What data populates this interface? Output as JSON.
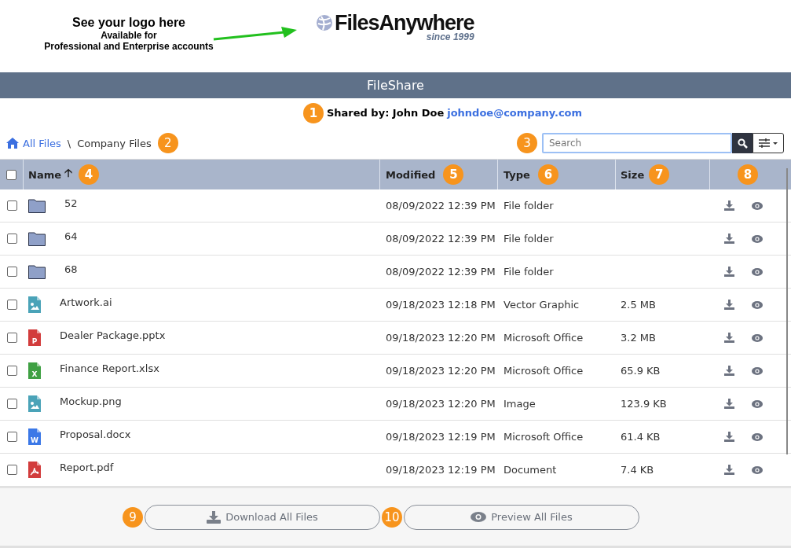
{
  "promo": {
    "headline": "See your logo here",
    "line_1": "Available for",
    "line_2": "Professional and Enterprise accounts"
  },
  "logo": {
    "name": "FilesAnywhere",
    "tagline": "since 1999"
  },
  "header": {
    "title": "FileShare"
  },
  "shared_by": {
    "callout": "1",
    "label": "Shared by: John Doe",
    "email": "johndoe@company.com"
  },
  "breadcrumb": {
    "items": [
      "All Files",
      "Company Files"
    ],
    "separator": "\\",
    "callout": "2"
  },
  "search": {
    "callout": "3",
    "placeholder": "Search"
  },
  "table": {
    "select_all_checked": false,
    "columns": [
      {
        "label": "Name",
        "sort_icon": "🡡",
        "callout": "4"
      },
      {
        "label": "Modified",
        "callout": "5"
      },
      {
        "label": "Type",
        "callout": "6"
      },
      {
        "label": "Size",
        "callout": "7"
      },
      {
        "callout": "8"
      }
    ],
    "rows": [
      {
        "kind": "folder",
        "name": "52",
        "modified": "08/09/2022 12:39 PM",
        "type": "File folder",
        "size": "",
        "checked": false
      },
      {
        "kind": "folder",
        "name": "64",
        "modified": "08/09/2022 12:39 PM",
        "type": "File folder",
        "size": "",
        "checked": false
      },
      {
        "kind": "folder",
        "name": "68",
        "modified": "08/09/2022 12:39 PM",
        "type": "File folder",
        "size": "",
        "checked": false
      },
      {
        "kind": "image",
        "name": "Artwork.ai",
        "modified": "09/18/2023 12:18 PM",
        "type": "Vector Graphic",
        "size": "2.5 MB",
        "checked": false
      },
      {
        "kind": "powerpoint",
        "icon_letter": "P",
        "name": "Dealer Package.pptx",
        "modified": "09/18/2023 12:20 PM",
        "type": "Microsoft Office",
        "size": "3.2 MB",
        "checked": false
      },
      {
        "kind": "excel",
        "icon_letter": "X",
        "name": "Finance Report.xlsx",
        "modified": "09/18/2023 12:20 PM",
        "type": "Microsoft Office",
        "size": "65.9 KB",
        "checked": false
      },
      {
        "kind": "image",
        "name": "Mockup.png",
        "modified": "09/18/2023 12:20 PM",
        "type": "Image",
        "size": "123.9 KB",
        "checked": false
      },
      {
        "kind": "word",
        "icon_letter": "W",
        "name": "Proposal.docx",
        "modified": "09/18/2023 12:19 PM",
        "type": "Microsoft Office",
        "size": "61.4 KB",
        "checked": false
      },
      {
        "kind": "pdf",
        "name": "Report.pdf",
        "modified": "09/18/2023 12:19 PM",
        "type": "Document",
        "size": "7.4 KB",
        "checked": false
      }
    ]
  },
  "footer": {
    "buttons": [
      {
        "kind": "download",
        "label": "Download All Files",
        "callout": "9"
      },
      {
        "kind": "preview",
        "label": "Preview All Files",
        "callout": "10"
      }
    ]
  }
}
